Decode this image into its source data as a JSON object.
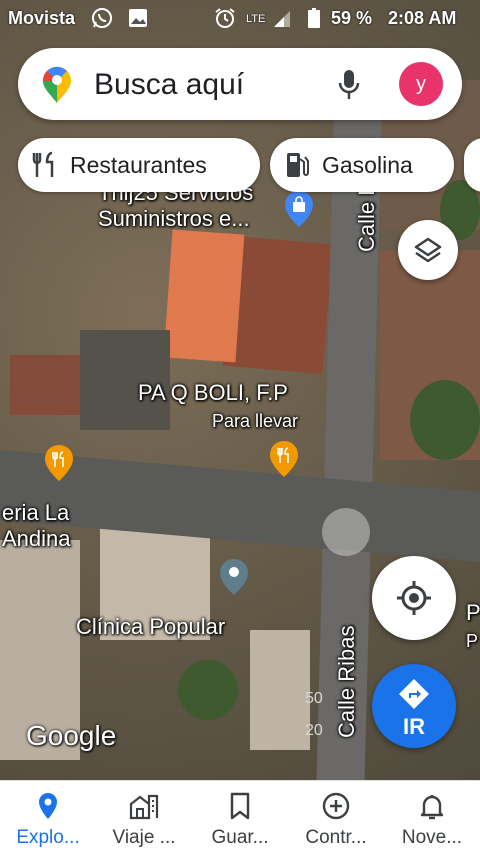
{
  "status_bar": {
    "carrier": "Movista",
    "network": "LTE",
    "battery": "59 %",
    "time": "2:08 AM",
    "icons": [
      "whatsapp-icon",
      "gallery-icon",
      "alarm-icon",
      "signal-icon",
      "battery-icon"
    ]
  },
  "search": {
    "placeholder": "Busca aquí",
    "avatar_initial": "y",
    "avatar_color": "#e8336b"
  },
  "chips": [
    {
      "label": "Restaurantes",
      "icon": "restaurant-icon"
    },
    {
      "label": "Gasolina",
      "icon": "gas-station-icon"
    }
  ],
  "map": {
    "places": [
      {
        "name_line1": "Thij25 Servicios",
        "name_line2": "Suministros e...",
        "icon": "shopping-bag-pin-icon"
      },
      {
        "name": "PA Q BOLI, F.P",
        "subtitle": "Para llevar",
        "icon": "restaurant-pin-icon"
      },
      {
        "name_line1": "eria La",
        "name_line2": "Andina",
        "icon": "restaurant-pin-icon"
      },
      {
        "name": "Clínica Popular",
        "icon": "place-pin-icon"
      }
    ],
    "streets": [
      "Calle Ribas",
      "Calle Ribas"
    ],
    "edge_labels": [
      "P",
      "P"
    ],
    "scale_labels": [
      "50",
      "20"
    ],
    "attribution": "Google"
  },
  "buttons": {
    "go_label": "IR",
    "accent": "#1a73e8"
  },
  "bottom_nav": [
    {
      "label": "Explo...",
      "icon": "explore-pin-icon",
      "active": true
    },
    {
      "label": "Viaje ...",
      "icon": "commute-icon",
      "active": false
    },
    {
      "label": "Guar...",
      "icon": "bookmark-icon",
      "active": false
    },
    {
      "label": "Contr...",
      "icon": "add-circle-icon",
      "active": false
    },
    {
      "label": "Nove...",
      "icon": "bell-icon",
      "active": false
    }
  ]
}
